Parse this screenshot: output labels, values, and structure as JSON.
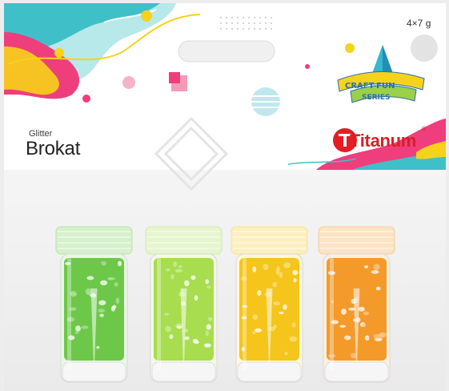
{
  "package": {
    "quantity_label": "4×7 g",
    "subtitle": "Glitter",
    "title": "Brokat",
    "brand": "Titanum",
    "series_badge": "CRAFT-FUN SERIES",
    "registered_mark": "®"
  },
  "tubes": [
    {
      "color_name": "green",
      "color": "#6dc84a"
    },
    {
      "color_name": "lime",
      "color": "#a7dd4f"
    },
    {
      "color_name": "yellow",
      "color": "#f6c51b"
    },
    {
      "color_name": "orange",
      "color": "#f49a2b"
    }
  ],
  "colors": {
    "pink": "#ef3e7c",
    "teal": "#3fc0c9",
    "yellow": "#f6d21a",
    "brand_red": "#d81f26"
  }
}
